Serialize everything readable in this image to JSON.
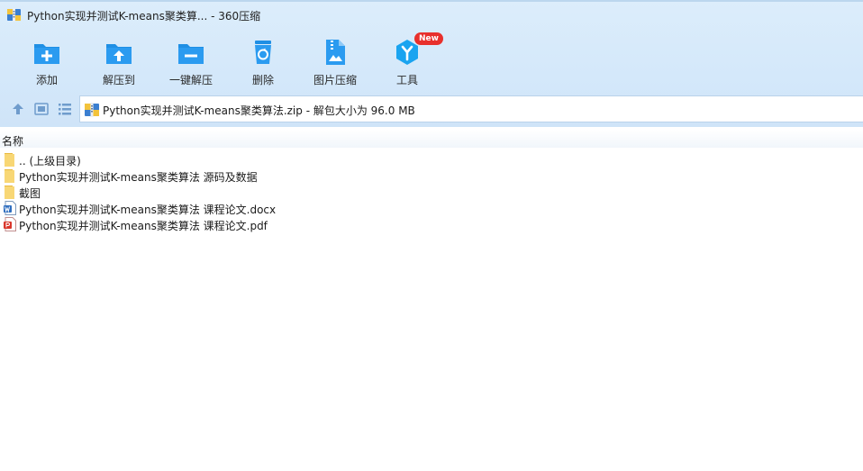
{
  "window": {
    "title": "Python实现并测试K-means聚类算... - 360压缩"
  },
  "toolbar": {
    "items": [
      {
        "label": "添加",
        "icon": "add-icon"
      },
      {
        "label": "解压到",
        "icon": "extract-to-icon"
      },
      {
        "label": "一键解压",
        "icon": "one-click-extract-icon"
      },
      {
        "label": "删除",
        "icon": "recycle-bin-icon"
      },
      {
        "label": "图片压缩",
        "icon": "image-compress-icon"
      },
      {
        "label": "工具",
        "icon": "tools-icon",
        "badge": "New"
      }
    ]
  },
  "address": {
    "path": "Python实现并测试K-means聚类算法.zip - 解包大小为 96.0 MB"
  },
  "columns": {
    "name": "名称"
  },
  "files": [
    {
      "name": ".. (上级目录)",
      "type": "parent-folder"
    },
    {
      "name": "Python实现并测试K-means聚类算法 源码及数据",
      "type": "folder"
    },
    {
      "name": "截图",
      "type": "folder"
    },
    {
      "name": "Python实现并测试K-means聚类算法 课程论文.docx",
      "type": "word"
    },
    {
      "name": "Python实现并测试K-means聚类算法 课程论文.pdf",
      "type": "pdf"
    }
  ],
  "colors": {
    "toolbar_icon": "#1f8fe4",
    "tools_icon": "#1aa4f0",
    "badge": "#e8302c",
    "folder": "#f8d775"
  }
}
